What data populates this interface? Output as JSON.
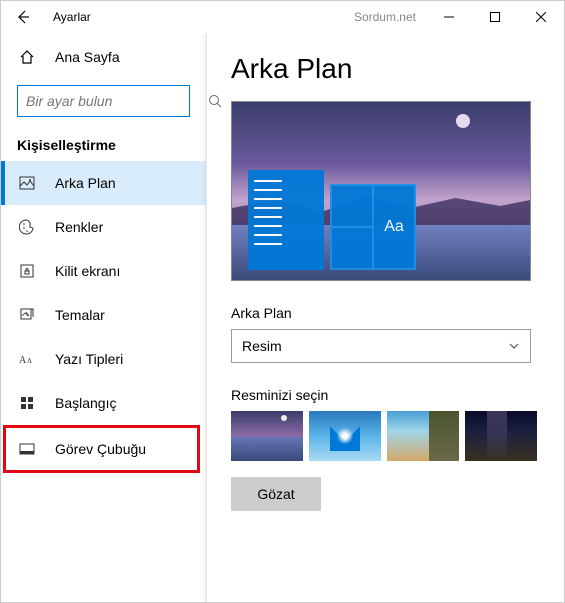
{
  "titlebar": {
    "title": "Ayarlar",
    "watermark": "Sordum.net"
  },
  "sidebar": {
    "home": "Ana Sayfa",
    "search_placeholder": "Bir ayar bulun",
    "section": "Kişiselleştirme",
    "items": [
      {
        "label": "Arka Plan"
      },
      {
        "label": "Renkler"
      },
      {
        "label": "Kilit ekranı"
      },
      {
        "label": "Temalar"
      },
      {
        "label": "Yazı Tipleri"
      },
      {
        "label": "Başlangıç"
      },
      {
        "label": "Görev Çubuğu"
      }
    ]
  },
  "main": {
    "title": "Arka Plan",
    "bg_label": "Arka Plan",
    "bg_value": "Resim",
    "choose_label": "Resminizi seçin",
    "browse": "Gözat",
    "preview_sample": "Aa"
  }
}
